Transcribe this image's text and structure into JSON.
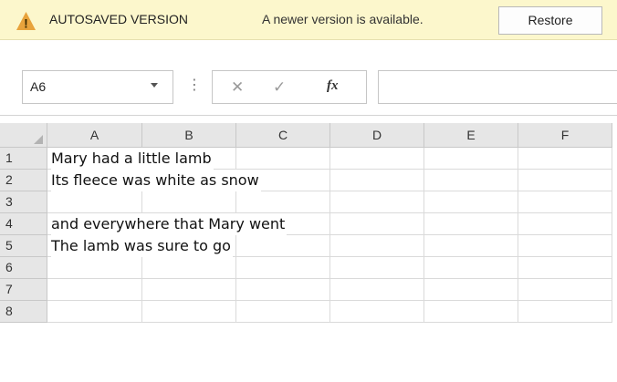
{
  "notice": {
    "title": "AUTOSAVED VERSION",
    "message": "A newer version is available.",
    "restore_label": "Restore",
    "icon": "warning-icon",
    "icon_mark": "!",
    "background": "#fcf7cc",
    "icon_color": "#e8a33c"
  },
  "formula_bar": {
    "name_box": "A6",
    "separator": "⋮",
    "cancel_symbol": "✕",
    "enter_symbol": "✓",
    "fx_label": "fx",
    "formula_value": ""
  },
  "sheet": {
    "columns": [
      "A",
      "B",
      "C",
      "D",
      "E",
      "F"
    ],
    "rows": [
      {
        "num": "1",
        "text": "Mary had a little lamb"
      },
      {
        "num": "2",
        "text": "Its fleece was white as snow"
      },
      {
        "num": "3",
        "text": ""
      },
      {
        "num": "4",
        "text": "and everywhere that Mary went"
      },
      {
        "num": "5",
        "text": "The lamb was sure to go"
      },
      {
        "num": "6",
        "text": ""
      },
      {
        "num": "7",
        "text": ""
      },
      {
        "num": "8",
        "text": ""
      }
    ]
  }
}
